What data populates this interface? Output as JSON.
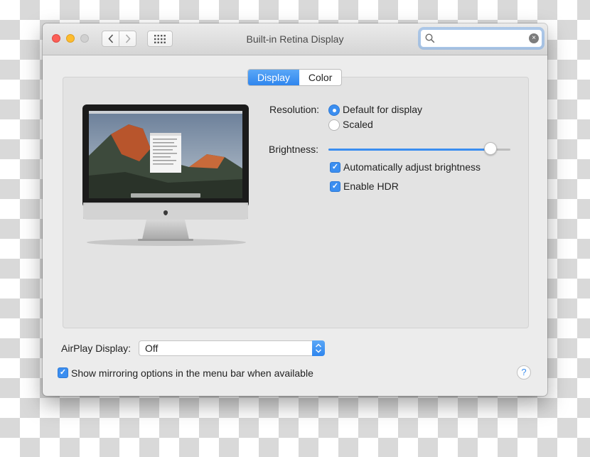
{
  "window": {
    "title": "Built-in Retina Display"
  },
  "search": {
    "value": "",
    "clear_glyph": "×"
  },
  "tabs": [
    {
      "label": "Display",
      "active": true
    },
    {
      "label": "Color",
      "active": false
    }
  ],
  "resolution": {
    "label": "Resolution:",
    "options": [
      {
        "label": "Default for display",
        "selected": true
      },
      {
        "label": "Scaled",
        "selected": false
      }
    ]
  },
  "brightness": {
    "label": "Brightness:",
    "level": 0.89,
    "auto_adjust": {
      "label": "Automatically adjust brightness",
      "checked": true
    },
    "hdr": {
      "label": "Enable HDR",
      "checked": true
    }
  },
  "airplay": {
    "label": "AirPlay Display:",
    "value": "Off"
  },
  "mirroring": {
    "label": "Show mirroring options in the menu bar when available",
    "checked": true
  },
  "help": {
    "glyph": "?"
  },
  "colors": {
    "accent": "#3b8ef0",
    "close": "#fc5f57",
    "minimize": "#fdbc2e"
  }
}
